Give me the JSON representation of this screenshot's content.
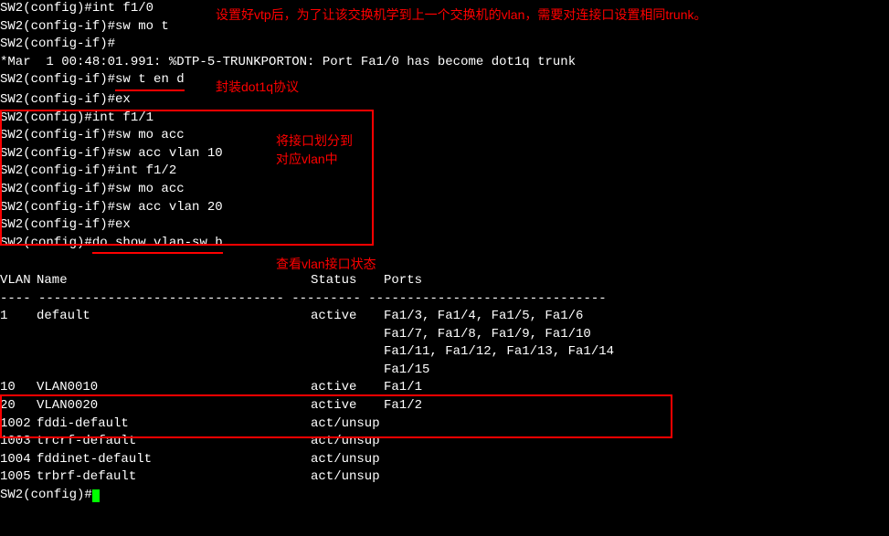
{
  "annotations": {
    "top": "设置好vtp后，为了让该交换机学到上一个交换机的vlan，需要对连接口设置相同trunk。",
    "dot1q": "封装dot1q协议",
    "vlan_assign": "将接口划分到\n对应vlan中",
    "show_vlan": "查看vlan接口状态"
  },
  "terminal": {
    "l1": "SW2(config)#int f1/0",
    "l2": "SW2(config-if)#sw mo t",
    "l3": "SW2(config-if)#",
    "l4": "*Mar  1 00:48:01.991: %DTP-5-TRUNKPORTON: Port Fa1/0 has become dot1q trunk",
    "l5a": "SW2(config-if)#",
    "l5b": "sw t en d",
    "l6": "SW2(config-if)#ex",
    "l7": "SW2(config)#int f1/1",
    "l8": "SW2(config-if)#sw mo acc",
    "l9": "SW2(config-if)#sw acc vlan 10",
    "l10": "SW2(config-if)#int f1/2",
    "l11": "SW2(config-if)#sw mo acc",
    "l12": "SW2(config-if)#sw acc vlan 20",
    "l13": "SW2(config-if)#ex",
    "l14a": "SW2(config)#",
    "l14b": "do show vlan-sw b",
    "blank": " ",
    "hdr_vlan": "VLAN",
    "hdr_name": "Name",
    "hdr_status": "Status",
    "hdr_ports": "Ports",
    "hr": "---- -------------------------------- --------- -------------------------------",
    "vlans": [
      {
        "id": "1",
        "name": "default",
        "status": "active",
        "ports": "Fa1/3, Fa1/4, Fa1/5, Fa1/6"
      },
      {
        "id": "",
        "name": "",
        "status": "",
        "ports": "Fa1/7, Fa1/8, Fa1/9, Fa1/10"
      },
      {
        "id": "",
        "name": "",
        "status": "",
        "ports": "Fa1/11, Fa1/12, Fa1/13, Fa1/14"
      },
      {
        "id": "",
        "name": "",
        "status": "",
        "ports": "Fa1/15"
      },
      {
        "id": "10",
        "name": "VLAN0010",
        "status": "active",
        "ports": "Fa1/1"
      },
      {
        "id": "20",
        "name": "VLAN0020",
        "status": "active",
        "ports": "Fa1/2"
      },
      {
        "id": "1002",
        "name": "fddi-default",
        "status": "act/unsup",
        "ports": ""
      },
      {
        "id": "1003",
        "name": "trcrf-default",
        "status": "act/unsup",
        "ports": ""
      },
      {
        "id": "1004",
        "name": "fddinet-default",
        "status": "act/unsup",
        "ports": ""
      },
      {
        "id": "1005",
        "name": "trbrf-default",
        "status": "act/unsup",
        "ports": ""
      }
    ],
    "prompt_end": "SW2(config)#"
  }
}
